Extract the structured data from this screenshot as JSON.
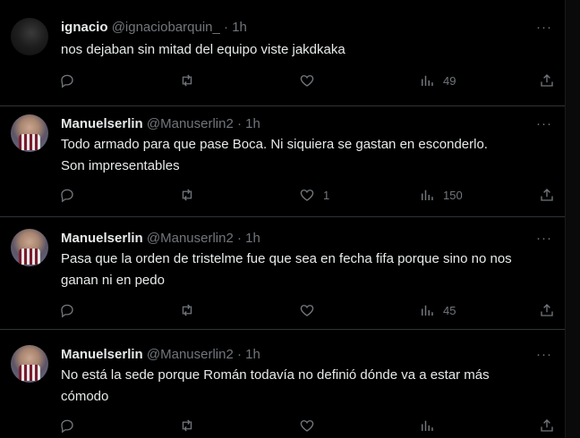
{
  "more_glyph": "···",
  "tweets": [
    {
      "avatar_icon": "dark-avatar",
      "name": "ignacio",
      "handle": "@ignaciobarquin_",
      "separator": "·",
      "time": "1h",
      "lines": [
        "nos dejaban sin mitad del equipo viste jakdkaka"
      ],
      "replies": "",
      "retweets": "",
      "likes": "",
      "views": "49"
    },
    {
      "avatar_icon": "person-avatar",
      "name": "Manuelserlin",
      "handle": "@Manuserlin2",
      "separator": "·",
      "time": "1h",
      "lines": [
        "Todo armado para que pase Boca. Ni siquiera se gastan en esconderlo.",
        "Son impresentables"
      ],
      "replies": "",
      "retweets": "",
      "likes": "1",
      "views": "150"
    },
    {
      "avatar_icon": "person-avatar",
      "name": "Manuelserlin",
      "handle": "@Manuserlin2",
      "separator": "·",
      "time": "1h",
      "lines": [
        "Pasa que la orden de tristelme fue que sea en fecha fifa porque sino no nos",
        "ganan ni en pedo"
      ],
      "replies": "",
      "retweets": "",
      "likes": "",
      "views": "45"
    },
    {
      "avatar_icon": "person-avatar",
      "name": "Manuelserlin",
      "handle": "@Manuserlin2",
      "separator": "·",
      "time": "1h",
      "lines": [
        "No está la sede porque Román todavía no definió dónde va a estar más",
        "cómodo"
      ],
      "replies": "",
      "retweets": "",
      "likes": "",
      "views": ""
    }
  ]
}
